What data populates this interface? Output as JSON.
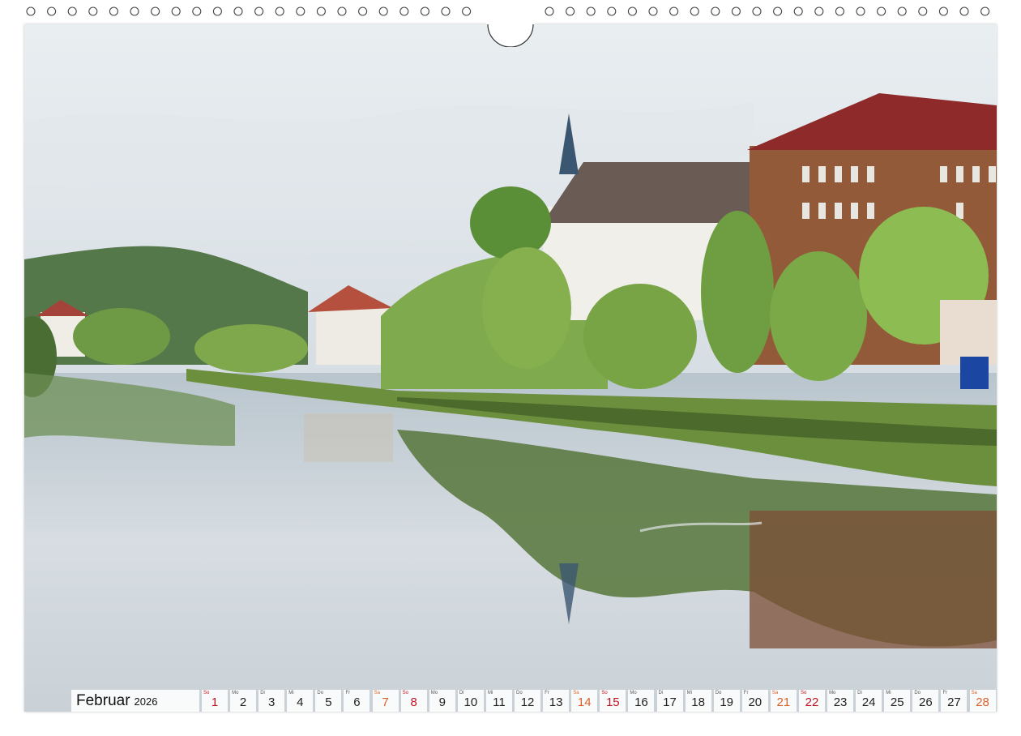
{
  "calendar": {
    "month": "Februar",
    "year": "2026",
    "days": [
      {
        "wd": "So",
        "n": "1",
        "type": "sun"
      },
      {
        "wd": "Mo",
        "n": "2",
        "type": "wk"
      },
      {
        "wd": "Di",
        "n": "3",
        "type": "wk"
      },
      {
        "wd": "Mi",
        "n": "4",
        "type": "wk"
      },
      {
        "wd": "Do",
        "n": "5",
        "type": "wk"
      },
      {
        "wd": "Fr",
        "n": "6",
        "type": "wk"
      },
      {
        "wd": "Sa",
        "n": "7",
        "type": "sat"
      },
      {
        "wd": "So",
        "n": "8",
        "type": "sun"
      },
      {
        "wd": "Mo",
        "n": "9",
        "type": "wk"
      },
      {
        "wd": "Di",
        "n": "10",
        "type": "wk"
      },
      {
        "wd": "Mi",
        "n": "11",
        "type": "wk"
      },
      {
        "wd": "Do",
        "n": "12",
        "type": "wk"
      },
      {
        "wd": "Fr",
        "n": "13",
        "type": "wk"
      },
      {
        "wd": "Sa",
        "n": "14",
        "type": "sat"
      },
      {
        "wd": "So",
        "n": "15",
        "type": "sun"
      },
      {
        "wd": "Mo",
        "n": "16",
        "type": "wk"
      },
      {
        "wd": "Di",
        "n": "17",
        "type": "wk"
      },
      {
        "wd": "Mi",
        "n": "18",
        "type": "wk"
      },
      {
        "wd": "Do",
        "n": "19",
        "type": "wk"
      },
      {
        "wd": "Fr",
        "n": "20",
        "type": "wk"
      },
      {
        "wd": "Sa",
        "n": "21",
        "type": "sat"
      },
      {
        "wd": "So",
        "n": "22",
        "type": "sun"
      },
      {
        "wd": "Mo",
        "n": "23",
        "type": "wk"
      },
      {
        "wd": "Di",
        "n": "24",
        "type": "wk"
      },
      {
        "wd": "Mi",
        "n": "25",
        "type": "wk"
      },
      {
        "wd": "Do",
        "n": "26",
        "type": "wk"
      },
      {
        "wd": "Fr",
        "n": "27",
        "type": "wk"
      },
      {
        "wd": "Sa",
        "n": "28",
        "type": "sat"
      }
    ]
  },
  "colors": {
    "sunday": "#c0141e",
    "saturday": "#d9622b",
    "weekday": "#222222"
  }
}
